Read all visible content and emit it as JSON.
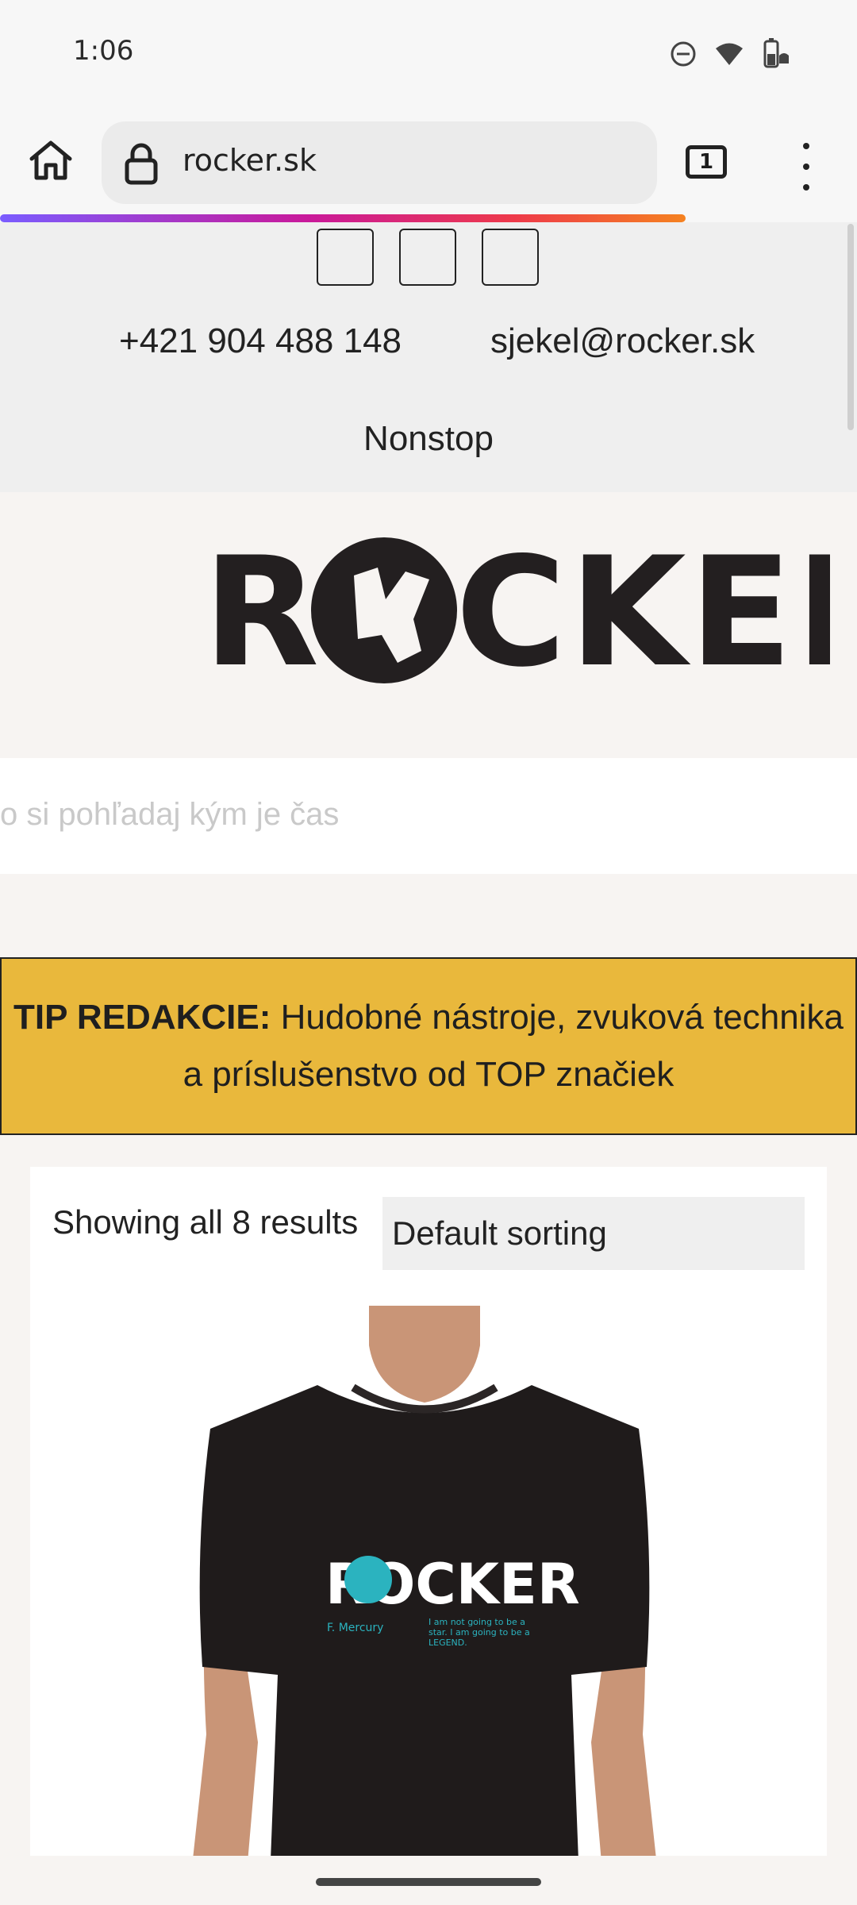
{
  "status_bar": {
    "time": "1:06",
    "icons": [
      "do-not-disturb-icon",
      "wifi-icon",
      "battery-icon"
    ]
  },
  "browser": {
    "url": "rocker.sk",
    "tab_count": "1",
    "load_progress": 0.8
  },
  "contact": {
    "phone": "+421 904 488 148",
    "email": "sjekel@rocker.sk",
    "hours": "Nonstop"
  },
  "social_icons": [
    "social-icon-1",
    "social-icon-2",
    "social-icon-3"
  ],
  "logo": {
    "text": "ROCKER"
  },
  "search": {
    "placeholder": "Čo si pohľadaj kým je čas",
    "visible_text": "o si pohľadaj kým je čas"
  },
  "tip": {
    "label": "TIP REDAKCIE:",
    "text": " Hudobné nástroje, zvuková technika a príslušenstvo od TOP značiek"
  },
  "shop": {
    "results_text": "Showing all 8 results",
    "sort_selected": "Default sorting"
  },
  "product": {
    "shirt_logo": "ROCKER",
    "shirt_name": "F. Mercury",
    "shirt_quote_1": "I am not going to be a",
    "shirt_quote_2": "star. I am going to be a",
    "shirt_quote_3": "LEGEND."
  },
  "colors": {
    "tip_bg": "#e9b83c",
    "accent_teal": "#2bb3bf",
    "shirt": "#1f1b1b"
  }
}
